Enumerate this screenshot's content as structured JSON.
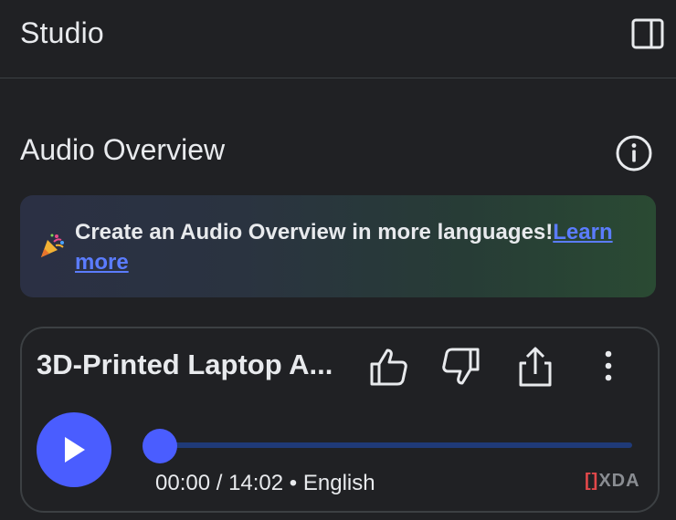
{
  "header": {
    "title": "Studio",
    "panel_icon": "sidebar-panel-icon"
  },
  "audio_overview": {
    "title": "Audio Overview",
    "info_icon": "info-icon",
    "banner": {
      "emoji_icon": "party-popper-icon",
      "text": "Create an Audio Overview in more languages!",
      "link_text": "Learn more"
    }
  },
  "player": {
    "title": "3D-Printed Laptop A...",
    "actions": [
      "thumbs-up-icon",
      "thumbs-down-icon",
      "share-icon",
      "more-vert-icon"
    ],
    "play_icon": "play-icon",
    "current_time": "00:00",
    "duration": "14:02",
    "time_display": "00:00 / 14:02 • English",
    "language": "English",
    "progress": 0
  },
  "watermark": {
    "bracket": "[]",
    "text": "XDA"
  },
  "colors": {
    "background": "#202124",
    "accent": "#4a5dff",
    "link": "#5b7cff",
    "track": "#1f3a78"
  }
}
